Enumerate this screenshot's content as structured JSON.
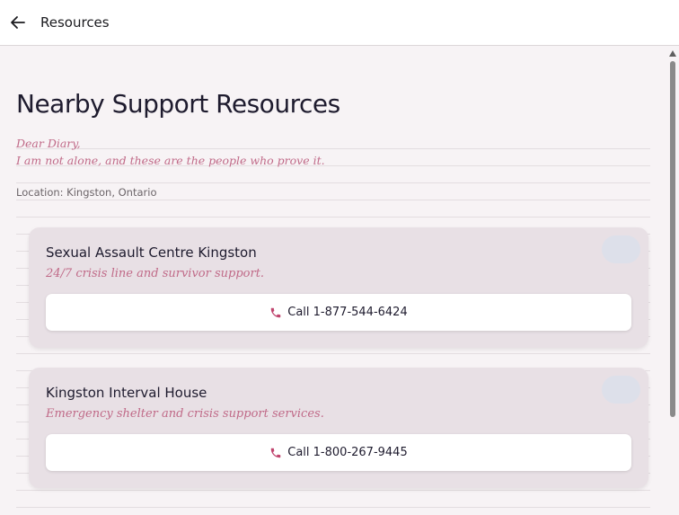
{
  "appbar": {
    "title": "Resources"
  },
  "page": {
    "title": "Nearby Support Resources",
    "diary_line1": "Dear Diary,",
    "diary_line2": "I am not alone, and these are the people who prove it.",
    "location": "Location: Kingston, Ontario"
  },
  "resources": [
    {
      "name": "Sexual Assault Centre Kingston",
      "description": "24/7 crisis line and survivor support.",
      "call_label": "Call 1-877-544-6424"
    },
    {
      "name": "Kingston Interval House",
      "description": "Emergency shelter and crisis support services.",
      "call_label": "Call 1-800-267-9445"
    }
  ],
  "icons": {
    "back": "arrow-left-icon",
    "phone": "phone-icon"
  },
  "colors": {
    "accent": "#c06a88",
    "background": "#f7f3f5",
    "card": "#e8e0e5",
    "text": "#1e1b2e"
  }
}
